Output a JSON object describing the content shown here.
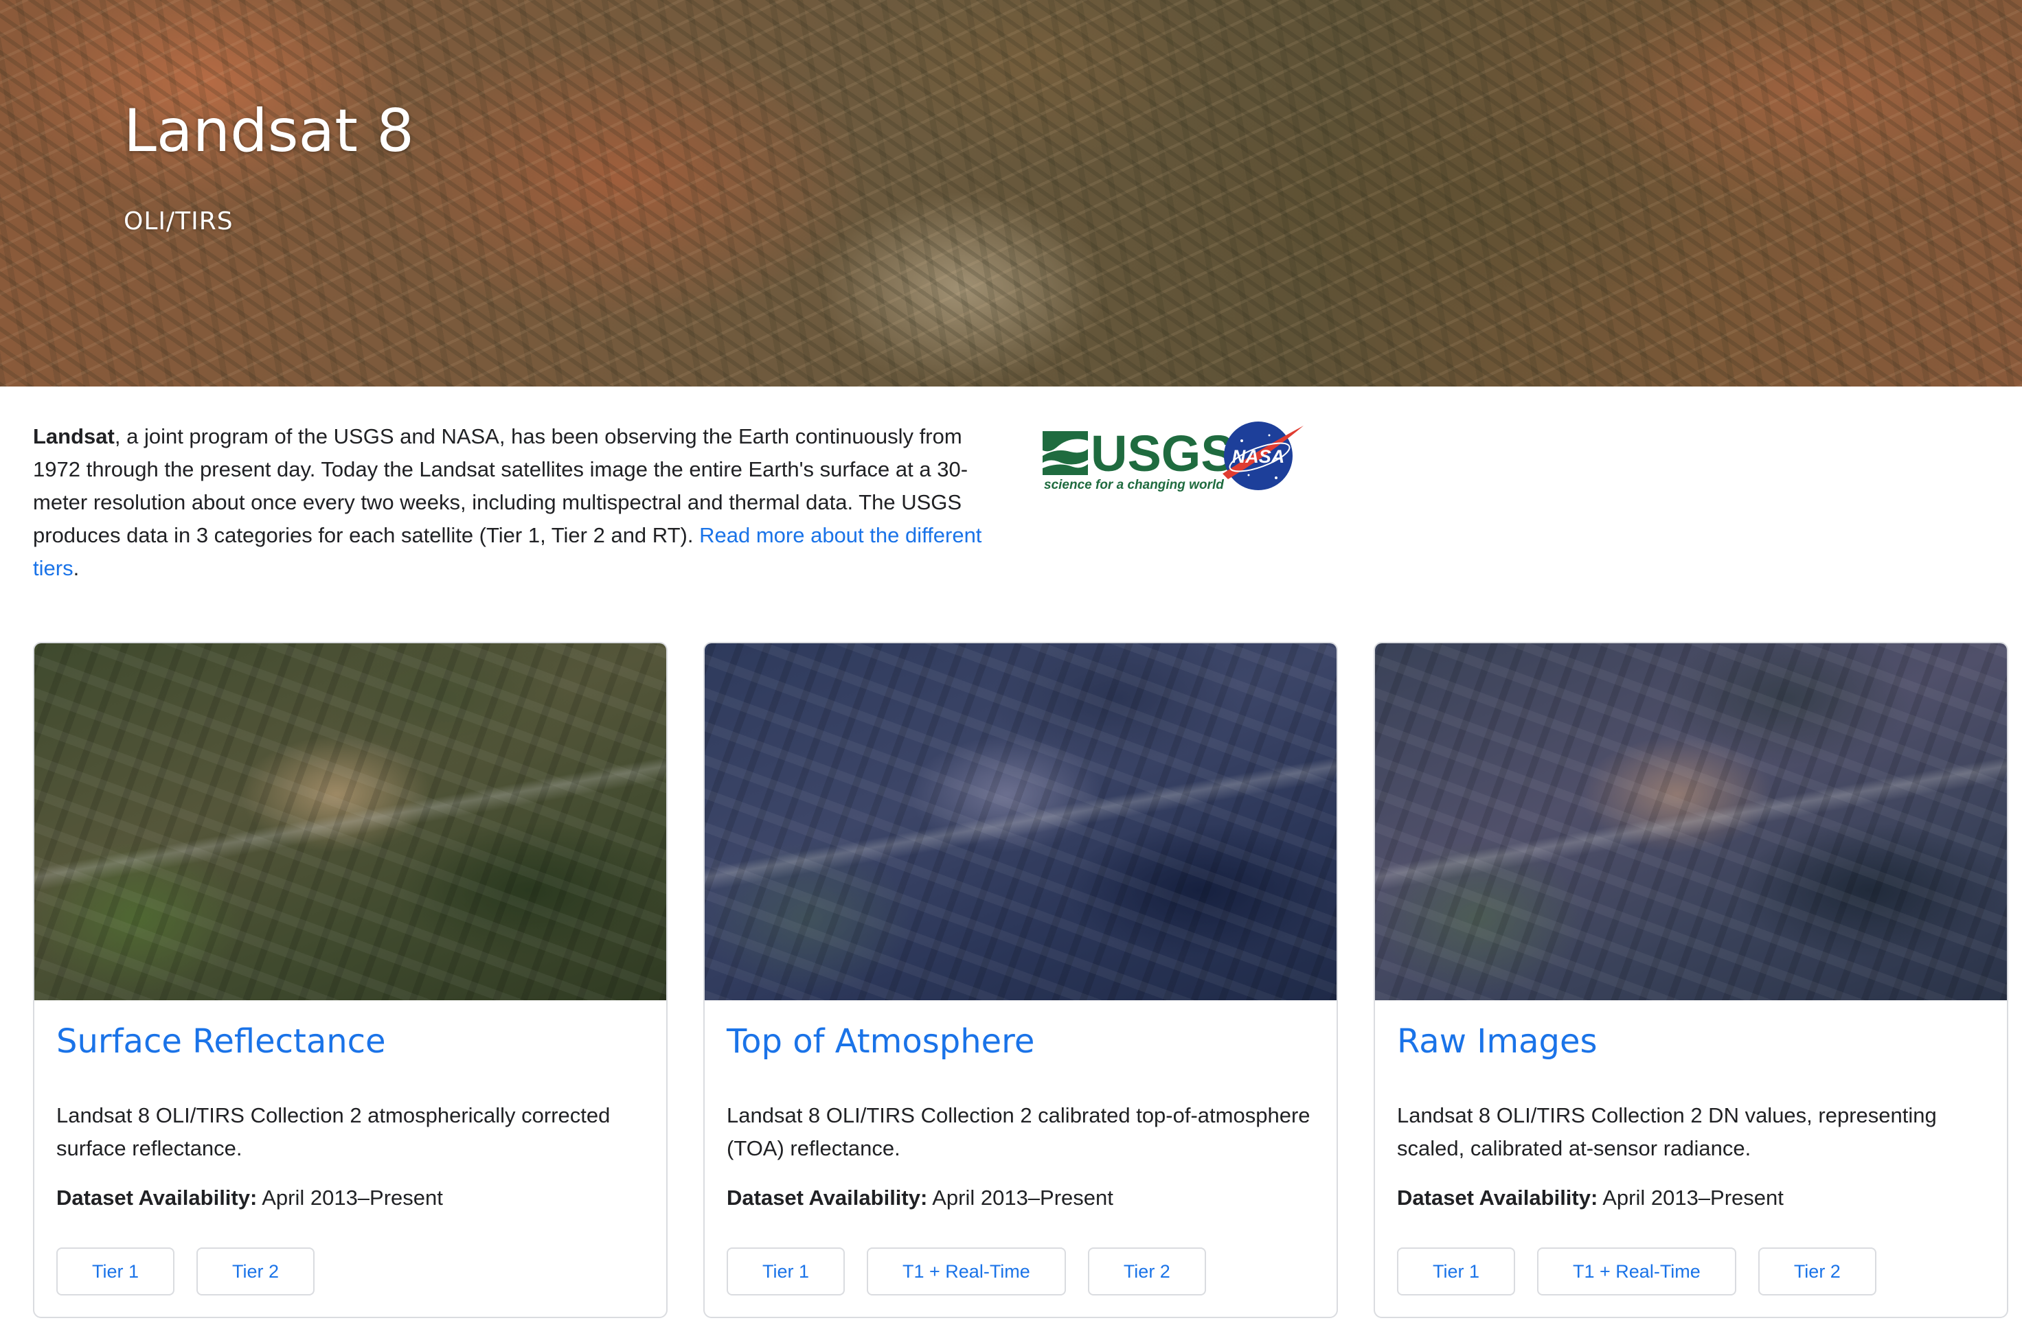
{
  "hero": {
    "title": "Landsat 8",
    "subtitle": "OLI/TIRS"
  },
  "intro": {
    "bold": "Landsat",
    "text": ", a joint program of the USGS and NASA, has been observing the Earth continuously from 1972 through the present day. Today the Landsat satellites image the entire Earth's surface at a 30-meter resolution about once every two weeks, including multispectral and thermal data. The USGS produces data in 3 categories for each satellite (Tier 1, Tier 2 and RT). ",
    "link": "Read more about the different tiers",
    "after": "."
  },
  "logos": {
    "usgs_text": "USGS",
    "usgs_tagline": "science for a changing world",
    "nasa_text": "NASA",
    "usgs_color": "#1f6b3f",
    "nasa_blue": "#1d3f9a",
    "nasa_red": "#e03c31"
  },
  "availability_label": "Dataset Availability:",
  "cards": [
    {
      "title": "Surface Reflectance",
      "description": "Landsat 8 OLI/TIRS Collection 2 atmospherically corrected surface reflectance.",
      "availability": " April 2013–Present",
      "buttons": [
        "Tier 1",
        "Tier 2"
      ]
    },
    {
      "title": "Top of Atmosphere",
      "description": "Landsat 8 OLI/TIRS Collection 2 calibrated top-of-atmosphere (TOA) reflectance.",
      "availability": " April 2013–Present",
      "buttons": [
        "Tier 1",
        "T1 + Real-Time",
        "Tier 2"
      ]
    },
    {
      "title": "Raw Images",
      "description": "Landsat 8 OLI/TIRS Collection 2 DN values, representing scaled, calibrated at-sensor radiance.",
      "availability": " April 2013–Present",
      "buttons": [
        "Tier 1",
        "T1 + Real-Time",
        "Tier 2"
      ]
    }
  ],
  "colors": {
    "link": "#1a73e8",
    "text": "#202124",
    "border": "#dadce0"
  }
}
